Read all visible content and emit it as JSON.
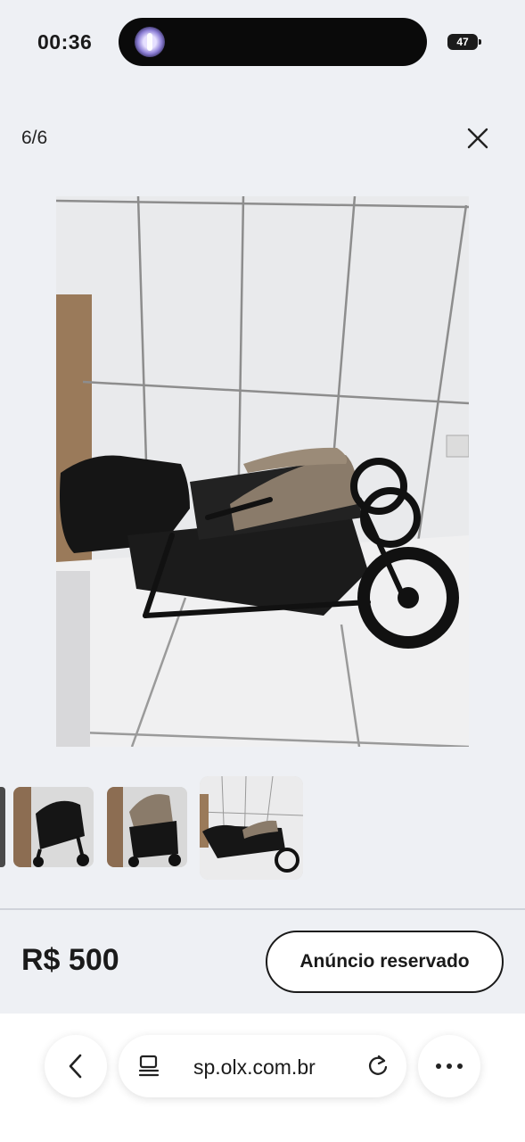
{
  "status_bar": {
    "time": "00:36",
    "battery": "47"
  },
  "gallery": {
    "counter": "6/6",
    "close_icon": "close-icon",
    "thumbnails": [
      "stroller-front-view",
      "stroller-side-view",
      "stroller-reclined-view"
    ],
    "selected_index": 2
  },
  "listing": {
    "price": "R$ 500",
    "status_button": "Anúncio reservado"
  },
  "browser": {
    "url": "sp.olx.com.br",
    "icons": [
      "back-icon",
      "page-icon",
      "reload-icon",
      "more-icon"
    ]
  }
}
